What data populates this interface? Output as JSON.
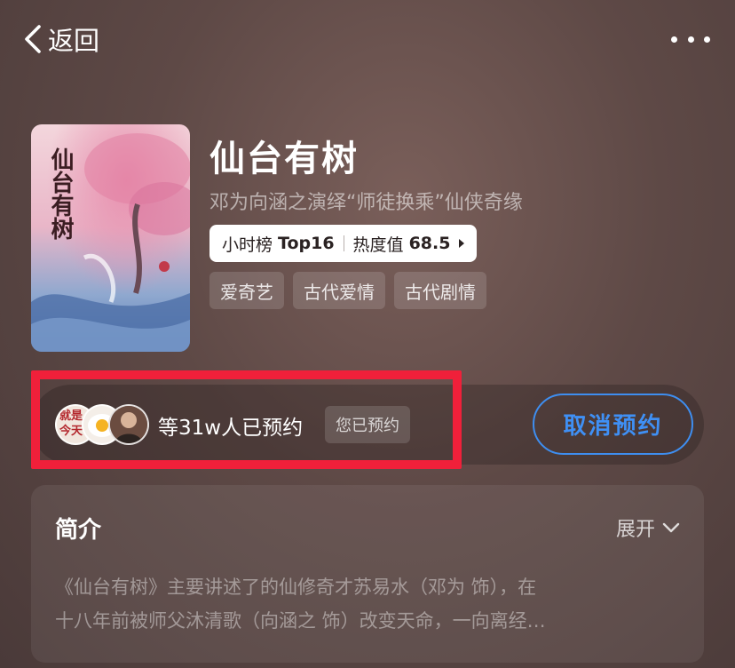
{
  "topbar": {
    "back_label": "返回",
    "more_icon": "more-horizontal-icon"
  },
  "show": {
    "title": "仙台有树",
    "subtitle": "邓为向涵之演绎“师徒换乘”仙侠奇缘",
    "rank_label": "小时榜",
    "rank_value": "Top16",
    "heat_label": "热度值",
    "heat_value": "68.5",
    "tags": [
      "爱奇艺",
      "古代爱情",
      "古代剧情"
    ],
    "poster_art_text": "仙台有树"
  },
  "reservation": {
    "count_text": "等31w人已预约",
    "status_badge": "您已预约",
    "cancel_label": "取消预约",
    "avatar_1_text": "就是今天",
    "accent_color": "#3f90f5",
    "highlight_color": "#f0203a"
  },
  "intro": {
    "title": "简介",
    "expand_label": "展开",
    "line_1": "《仙台有树》主要讲述了的仙修奇才苏易水（邓为 饰），在",
    "line_2": "十八年前被师父沐清歌（向涵之 饰）改变天命，一向离经…"
  }
}
